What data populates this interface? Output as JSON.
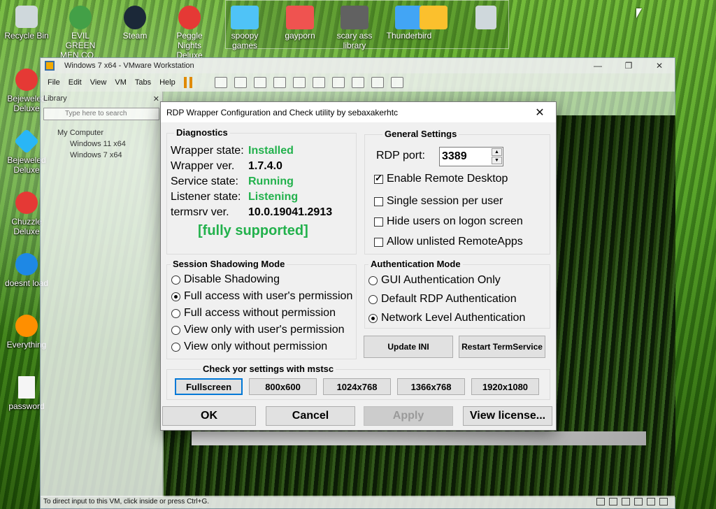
{
  "desktop": {
    "left_icons": [
      {
        "label": "Recycle Bin",
        "icon": "recycle-bin-icon",
        "color": "#cfd8dc"
      },
      {
        "label": "Bejeweled Deluxe",
        "icon": "bejeweled-icon",
        "color": "#e53935"
      },
      {
        "label": "Bejeweled Deluxe",
        "icon": "bejeweled-icon",
        "color": "#29b6f6"
      },
      {
        "label": "Chuzzle Deluxe",
        "icon": "chuzzle-icon",
        "color": "#e53935"
      },
      {
        "label": "doesnt load",
        "icon": "app-icon",
        "color": "#1e88e5"
      },
      {
        "label": "Everything",
        "icon": "search-icon",
        "color": "#ff8f00"
      },
      {
        "label": "password",
        "icon": "text-file-icon",
        "color": "#f5f5f5"
      }
    ],
    "top_icons": [
      {
        "label": "EVIL GREEN MEN CO...",
        "icon": "game-icon",
        "color": "#43a047"
      },
      {
        "label": "Steam",
        "icon": "steam-icon",
        "color": "#1b2838"
      },
      {
        "label": "Peggle Nights Deluxe",
        "icon": "peggle-icon",
        "color": "#e53935"
      },
      {
        "label": "spoopy games",
        "icon": "folder-icon",
        "color": "#4fc3f7"
      },
      {
        "label": "gayporn",
        "icon": "folder-icon",
        "color": "#ef5350"
      },
      {
        "label": "scary ass library",
        "icon": "folder-icon",
        "color": "#616161"
      },
      {
        "label": "Thunderbird",
        "icon": "thunderbird-icon",
        "color": "#42a5f5"
      },
      {
        "label": "",
        "icon": "folder-icon",
        "color": "#fbc02d"
      },
      {
        "label": "",
        "icon": "recycle-bin-icon",
        "color": "#cfd8dc"
      }
    ]
  },
  "vmware": {
    "title": "Windows 7 x64 - VMware Workstation",
    "window_controls": [
      "—",
      "❐",
      "✕"
    ],
    "menu": [
      "File",
      "Edit",
      "View",
      "VM",
      "Tabs",
      "Help"
    ],
    "library": {
      "title": "Library",
      "search_placeholder": "Type here to search",
      "root": "My Computer",
      "vms": [
        "Windows 11 x64",
        "Windows 7 x64"
      ]
    },
    "status": "To direct input to this VM, click inside or press Ctrl+G."
  },
  "rdp": {
    "title": "RDP Wrapper Configuration and Check utility by sebaxakerhtc",
    "close": "✕",
    "diagnostics": {
      "title": "Diagnostics",
      "rows": [
        {
          "label": "Wrapper state:",
          "value": "Installed",
          "green": true
        },
        {
          "label": "Wrapper ver.",
          "value": "1.7.4.0",
          "green": false
        },
        {
          "label": "Service state:",
          "value": "Running",
          "green": true
        },
        {
          "label": "Listener state:",
          "value": "Listening",
          "green": true
        },
        {
          "label": "termsrv ver.",
          "value": "10.0.19041.2913",
          "green": false
        }
      ],
      "support": "[fully supported]"
    },
    "general": {
      "title": "General Settings",
      "port_label": "RDP port:",
      "port_value": "3389",
      "options": [
        {
          "label": "Enable Remote Desktop",
          "checked": true
        },
        {
          "label": "Single session per user",
          "checked": false
        },
        {
          "label": "Hide users on logon screen",
          "checked": false
        },
        {
          "label": "Allow unlisted RemoteApps",
          "checked": false
        }
      ]
    },
    "shadow": {
      "title": "Session Shadowing Mode",
      "options": [
        {
          "label": "Disable Shadowing",
          "checked": false
        },
        {
          "label": "Full access with user's permission",
          "checked": true
        },
        {
          "label": "Full access without permission",
          "checked": false
        },
        {
          "label": "View only with user's permission",
          "checked": false
        },
        {
          "label": "View only without permission",
          "checked": false
        }
      ]
    },
    "auth": {
      "title": "Authentication Mode",
      "options": [
        {
          "label": "GUI Authentication Only",
          "checked": false
        },
        {
          "label": "Default RDP Authentication",
          "checked": false
        },
        {
          "label": "Network Level Authentication",
          "checked": true
        }
      ]
    },
    "update_ini": "Update INI",
    "restart": "Restart TermService",
    "mstsc": {
      "title": "Check yor settings with mstsc",
      "buttons": [
        "Fullscreen",
        "800x600",
        "1024x768",
        "1366x768",
        "1920x1080"
      ]
    },
    "ok": "OK",
    "cancel": "Cancel",
    "apply": "Apply",
    "license": "View license..."
  }
}
